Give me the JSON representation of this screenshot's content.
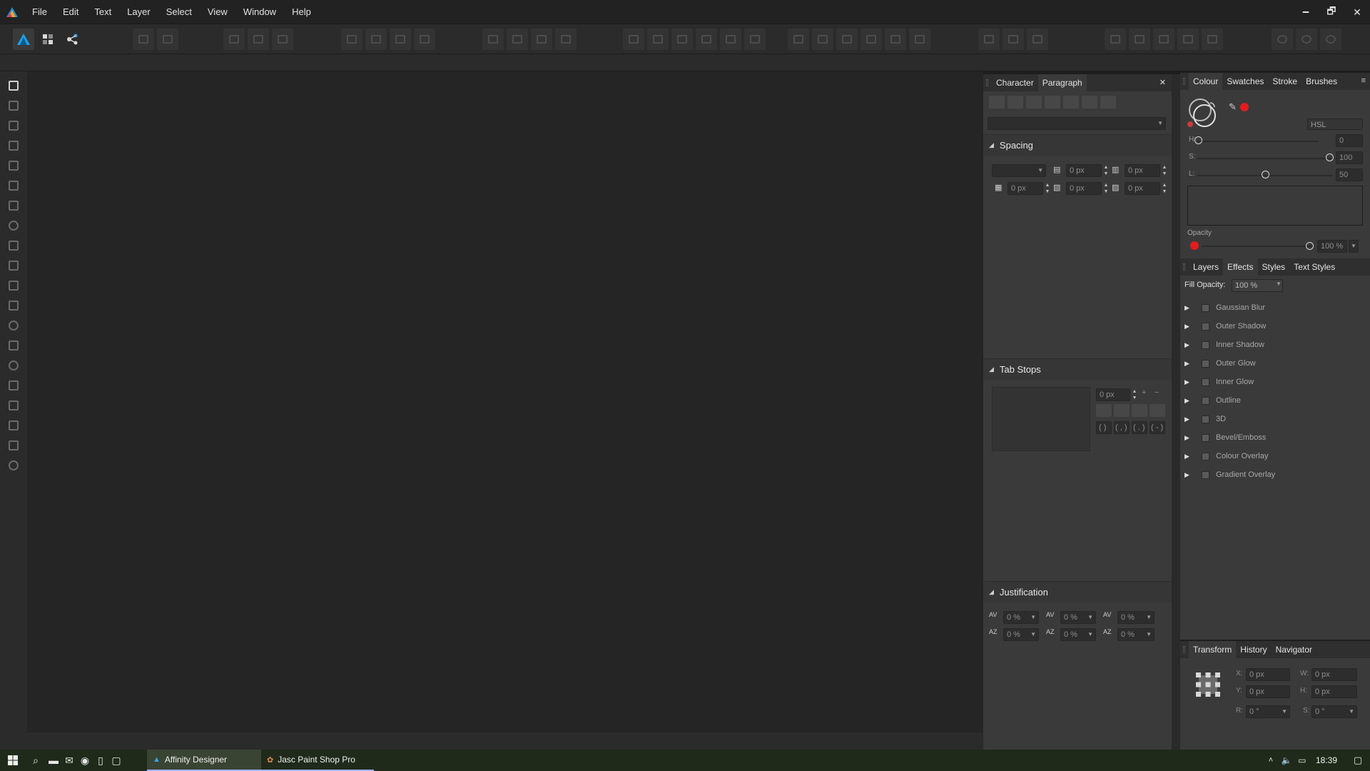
{
  "menu": [
    "File",
    "Edit",
    "Text",
    "Layer",
    "Select",
    "View",
    "Window",
    "Help"
  ],
  "window_controls": {
    "minimize": "🗕",
    "maximize": "🗗",
    "close": "✕"
  },
  "character_panel": {
    "tabs": [
      "Character",
      "Paragraph"
    ],
    "active_tab": "Paragraph",
    "close": "✕",
    "sections": {
      "spacing": "Spacing",
      "tab_stops": "Tab Stops",
      "justification": "Justification"
    },
    "spacing": {
      "space_before": "0 px",
      "space_after": "0 px",
      "left_indent": "0 px",
      "first_line_indent": "0 px",
      "right_indent": "0 px"
    },
    "tab_stops": {
      "position": "0 px",
      "chars": [
        "( )",
        "( , )",
        "( . )",
        "( - )"
      ]
    },
    "justification": {
      "values": [
        "0 %",
        "0 %",
        "0 %",
        "0 %",
        "0 %",
        "0 %"
      ]
    }
  },
  "colour_panel": {
    "tabs": [
      "Colour",
      "Swatches",
      "Stroke",
      "Brushes"
    ],
    "active_tab": "Colour",
    "model": "HSL",
    "h_label": "H:",
    "h_value": "0",
    "s_label": "S:",
    "s_value": "100",
    "l_label": "L:",
    "l_value": "50",
    "opacity_label": "Opacity",
    "opacity_value": "100 %",
    "accent_color": "#e11d1d"
  },
  "effects_panel": {
    "tabs": [
      "Layers",
      "Effects",
      "Styles",
      "Text Styles"
    ],
    "active_tab": "Effects",
    "fill_opacity_label": "Fill Opacity:",
    "fill_opacity_value": "100 %",
    "effects": [
      "Gaussian Blur",
      "Outer Shadow",
      "Inner Shadow",
      "Outer Glow",
      "Inner Glow",
      "Outline",
      "3D",
      "Bevel/Emboss",
      "Colour Overlay",
      "Gradient Overlay"
    ]
  },
  "transform_panel": {
    "tabs": [
      "Transform",
      "History",
      "Navigator"
    ],
    "active_tab": "Transform",
    "x_label": "X:",
    "x_value": "0 px",
    "y_label": "Y:",
    "y_value": "0 px",
    "w_label": "W:",
    "w_value": "0 px",
    "h_label": "H:",
    "h_value": "0 px",
    "r_label": "R:",
    "r_value": "0 °",
    "s_label": "S:",
    "s_value": "0 °"
  },
  "taskbar": {
    "apps": [
      "Affinity Designer",
      "Jasc Paint Shop Pro"
    ],
    "clock": "18:39"
  }
}
